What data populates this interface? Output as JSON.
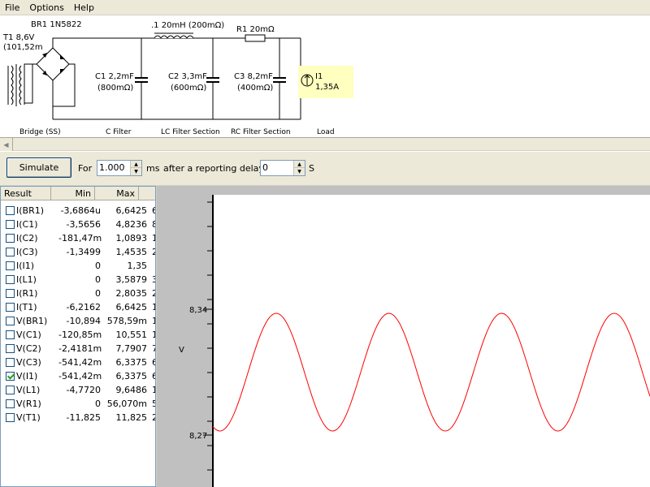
{
  "menu": [
    "File",
    "Options",
    "Help"
  ],
  "schematic": {
    "components": {
      "t1": "T1 8,6V",
      "t1_res": "(101,52m",
      "br1": "BR1 1N5822",
      "l1": ".1 20mH (200mΩ)",
      "r1": "R1 20mΩ",
      "c1_name": "C1 2,2mF",
      "c1_res": "(800mΩ)",
      "c2_name": "C2 3,3mF",
      "c2_res": "(600mΩ)",
      "c3_name": "C3 8,2mF",
      "c3_res": "(400mΩ)",
      "i1_name": "I1",
      "i1_val": "1,35A"
    },
    "sections": [
      "Bridge (SS)",
      "C Filter",
      "LC Filter Section",
      "RC Filter Section",
      "Load"
    ]
  },
  "simulation": {
    "button": "Simulate",
    "for_label": "For",
    "for_value": "1.000",
    "ms_label": "ms",
    "delay_label": "after a reporting delay of",
    "delay_value": "0",
    "s_label": "S"
  },
  "results": {
    "headers": [
      "Result",
      "Min",
      "Max"
    ],
    "rows": [
      {
        "name": "I(BR1)",
        "min": "-3,6864u",
        "max": "6,6425",
        "extra": "6",
        "checked": false
      },
      {
        "name": "I(C1)",
        "min": "-3,5656",
        "max": "4,8236",
        "extra": "8",
        "checked": false
      },
      {
        "name": "I(C2)",
        "min": "-181,47m",
        "max": "1,0893",
        "extra": "1",
        "checked": false
      },
      {
        "name": "I(C3)",
        "min": "-1,3499",
        "max": "1,4535",
        "extra": "2",
        "checked": false
      },
      {
        "name": "I(I1)",
        "min": "0",
        "max": "1,35",
        "extra": "",
        "checked": false
      },
      {
        "name": "I(L1)",
        "min": "0",
        "max": "3,5879",
        "extra": "3",
        "checked": false
      },
      {
        "name": "I(R1)",
        "min": "0",
        "max": "2,8035",
        "extra": "2",
        "checked": false
      },
      {
        "name": "I(T1)",
        "min": "-6,2162",
        "max": "6,6425",
        "extra": "1",
        "checked": false
      },
      {
        "name": "V(BR1)",
        "min": "-10,894",
        "max": "578,59m",
        "extra": "1",
        "checked": false
      },
      {
        "name": "V(C1)",
        "min": "-120,85m",
        "max": "10,551",
        "extra": "1",
        "checked": false
      },
      {
        "name": "V(C2)",
        "min": "-2,4181m",
        "max": "7,7907",
        "extra": "7",
        "checked": false
      },
      {
        "name": "V(C3)",
        "min": "-541,42m",
        "max": "6,3375",
        "extra": "6",
        "checked": false
      },
      {
        "name": "V(I1)",
        "min": "-541,42m",
        "max": "6,3375",
        "extra": "6",
        "checked": true
      },
      {
        "name": "V(L1)",
        "min": "-4,7720",
        "max": "9,6486",
        "extra": "1",
        "checked": false
      },
      {
        "name": "V(R1)",
        "min": "0",
        "max": "56,070m",
        "extra": "56,",
        "checked": false
      },
      {
        "name": "V(T1)",
        "min": "-11,825",
        "max": "11,825",
        "extra": "2",
        "checked": false
      }
    ]
  },
  "graph": {
    "ylabel": "V",
    "yticks": [
      "8,34",
      "8,27"
    ],
    "wave_color": "#ff0000",
    "chart_data": {
      "type": "line",
      "ylabel": "V",
      "ylim": [
        8.27,
        8.34
      ],
      "series": [
        {
          "color": "#ff0000",
          "peaks": 4,
          "min": 8.27,
          "max": 8.34
        }
      ]
    }
  }
}
